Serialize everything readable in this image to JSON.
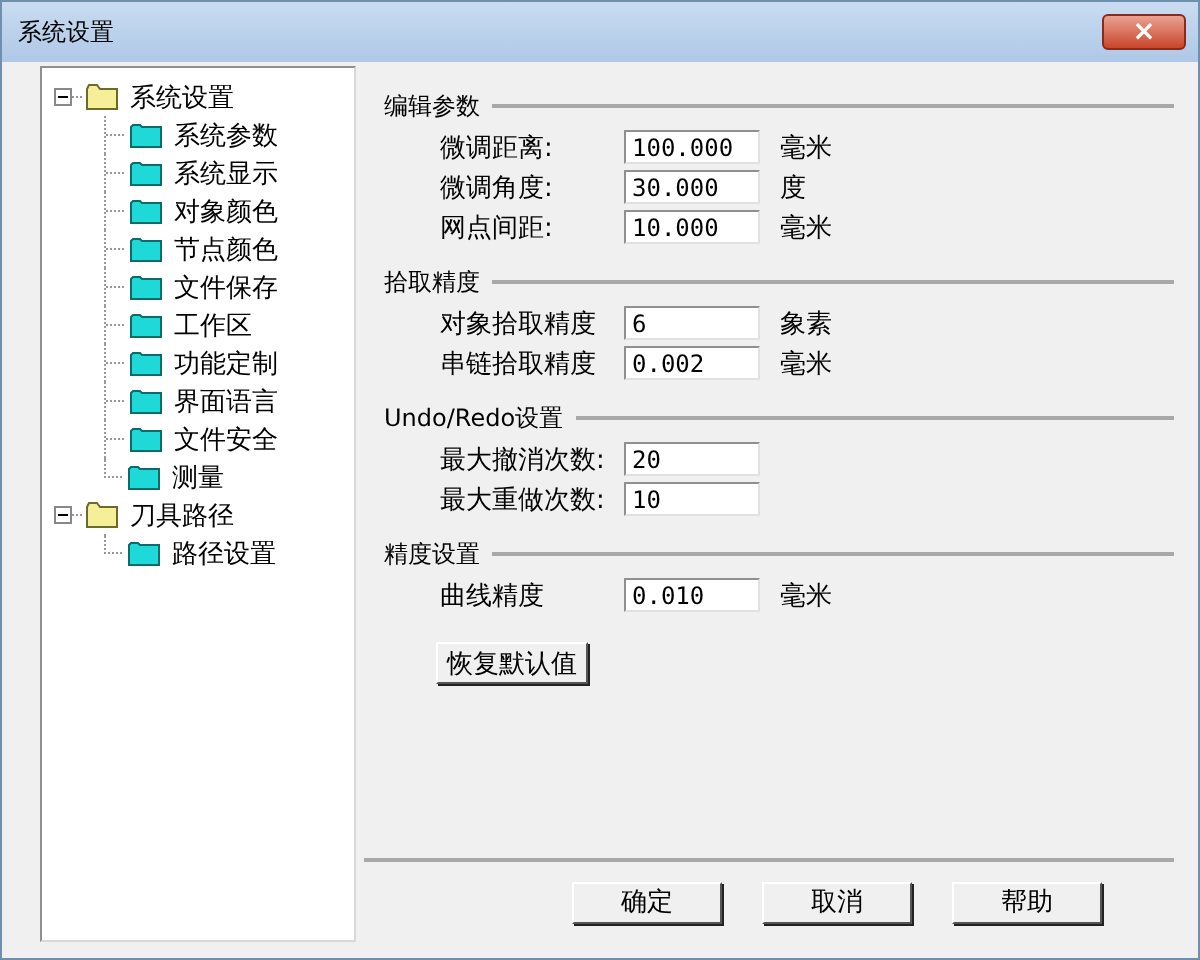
{
  "window": {
    "title": "系统设置",
    "close": "×"
  },
  "tree": [
    {
      "label": "系统设置",
      "expanded": true,
      "children": [
        {
          "label": "系统参数"
        },
        {
          "label": "系统显示"
        },
        {
          "label": "对象颜色"
        },
        {
          "label": "节点颜色"
        },
        {
          "label": "文件保存"
        },
        {
          "label": "工作区"
        },
        {
          "label": "功能定制"
        },
        {
          "label": "界面语言"
        },
        {
          "label": "文件安全"
        },
        {
          "label": "测量"
        }
      ]
    },
    {
      "label": "刀具路径",
      "expanded": true,
      "children": [
        {
          "label": "路径设置"
        }
      ]
    }
  ],
  "sections": [
    {
      "title": "编辑参数",
      "fields": [
        {
          "label": "微调距离:",
          "value": "100.000",
          "unit": "毫米"
        },
        {
          "label": "微调角度:",
          "value": "30.000",
          "unit": "度"
        },
        {
          "label": "网点间距:",
          "value": "10.000",
          "unit": "毫米"
        }
      ]
    },
    {
      "title": "拾取精度",
      "fields": [
        {
          "label": "对象拾取精度",
          "value": "6",
          "unit": "象素"
        },
        {
          "label": "串链拾取精度",
          "value": "0.002",
          "unit": "毫米"
        }
      ]
    },
    {
      "title": "Undo/Redo设置",
      "fields": [
        {
          "label": "最大撤消次数:",
          "value": "20"
        },
        {
          "label": "最大重做次数:",
          "value": "10"
        }
      ]
    },
    {
      "title": "精度设置",
      "fields": [
        {
          "label": "曲线精度",
          "value": "0.010",
          "unit": "毫米"
        }
      ]
    }
  ],
  "reset_button": "恢复默认值",
  "buttons": [
    "确定",
    "取消",
    "帮助"
  ]
}
